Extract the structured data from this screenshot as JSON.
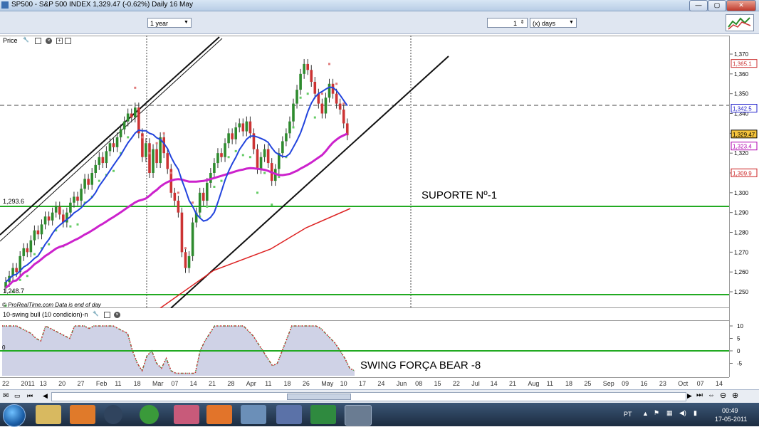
{
  "window": {
    "title": "SP500 - S&P 500 INDEX    1,329.47 (-0.62%)    Daily  16 May",
    "buttons": [
      "—",
      "▢",
      "✕"
    ]
  },
  "toolbar": {
    "period_value": "1 year",
    "count_value": "1",
    "unit_value": "(x) days"
  },
  "price_panel": {
    "label": "Price",
    "footer_text": "© ProRealTime.com  Data is end of day",
    "support_label": "SUPORTE Nº-1",
    "left_level_1": "1,293.6",
    "left_level_2": "1,248.7",
    "y_ticks": [
      "1,370",
      "1,360",
      "1,350",
      "1,340",
      "1,330",
      "1,320",
      "1,310",
      "1,300",
      "1,290",
      "1,280",
      "1,270",
      "1,260",
      "1,250"
    ],
    "badges": [
      {
        "value": "1,365.1",
        "color": "#cc3333",
        "bg": "#ffffff"
      },
      {
        "value": "1,342.5",
        "color": "#2222cc",
        "bg": "#ffffff"
      },
      {
        "value": "1,329.47",
        "color": "#000000",
        "bg": "#f5c43c"
      },
      {
        "value": "1,323.4",
        "color": "#b000b0",
        "bg": "#ffffff"
      },
      {
        "value": "1,309.9",
        "color": "#cc2222",
        "bg": "#ffffff"
      }
    ]
  },
  "indicator_panel": {
    "label": "10-swing bull (10 condicion)-n",
    "annotation": "SWING FORÇA BEAR -8",
    "y_ticks": [
      "10",
      "5",
      "0",
      "-5"
    ]
  },
  "date_axis": [
    "22",
    "2011",
    "13",
    "20",
    "27",
    "Feb",
    "11",
    "18",
    "Mar",
    "07",
    "14",
    "21",
    "28",
    "Apr",
    "11",
    "18",
    "26",
    "May",
    "10",
    "17",
    "24",
    "Jun",
    "08",
    "15",
    "22",
    "Jul",
    "14",
    "21",
    "Aug",
    "11",
    "18",
    "25",
    "Sep",
    "09",
    "16",
    "23",
    "Oct",
    "07",
    "14"
  ],
  "taskbar": {
    "language": "PT",
    "time": "00:49",
    "date": "17-05-2011"
  },
  "colors": {
    "up": "#2e8b2e",
    "down": "#cc3333",
    "ma_fast": "#2244dd",
    "ma_slow": "#cc22cc",
    "ma_long": "#dd2222",
    "support": "#22aa22",
    "indicator_fill": "#cfd2e6"
  }
}
